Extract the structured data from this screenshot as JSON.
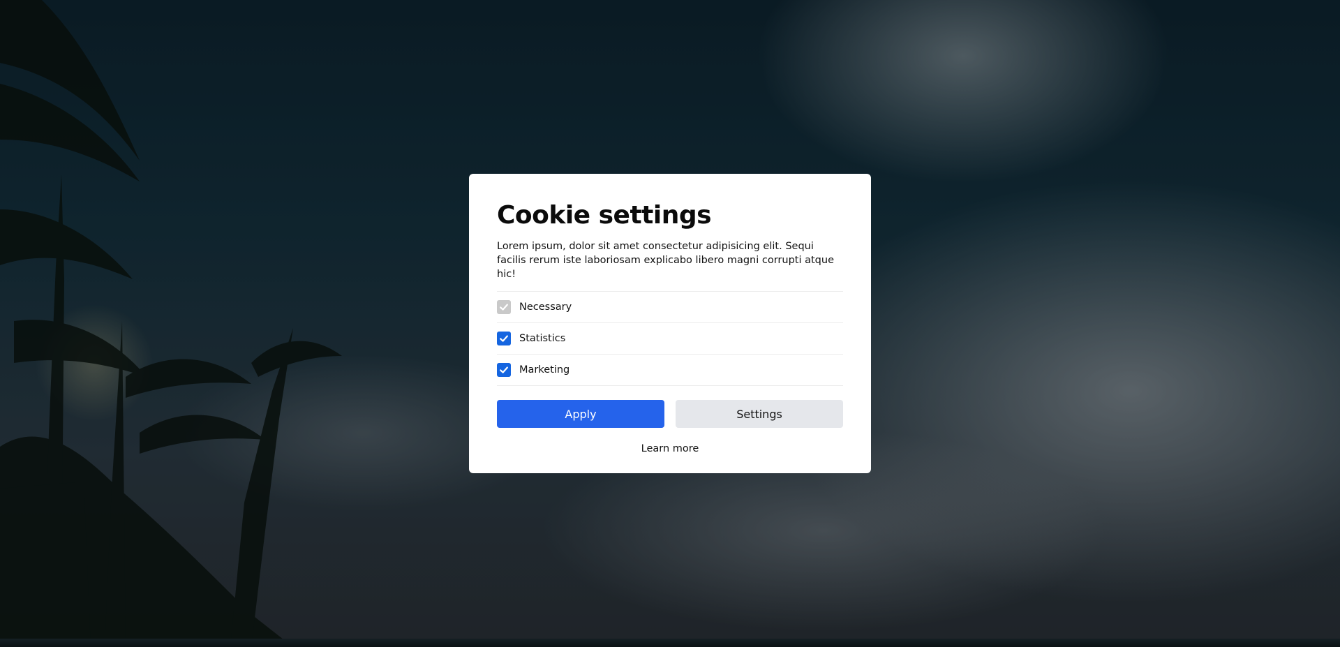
{
  "modal": {
    "title": "Cookie settings",
    "description": "Lorem ipsum, dolor sit amet consectetur adipisicing elit. Sequi facilis rerum iste laboriosam explicabo libero magni corrupti atque hic!",
    "options": [
      {
        "label": "Necessary",
        "checked": true,
        "disabled": true
      },
      {
        "label": "Statistics",
        "checked": true,
        "disabled": false
      },
      {
        "label": "Marketing",
        "checked": true,
        "disabled": false
      }
    ],
    "apply_label": "Apply",
    "settings_label": "Settings",
    "learn_more_label": "Learn more"
  },
  "icons": {
    "checkbox_check": "check-icon"
  },
  "colors": {
    "primary": "#2563eb",
    "checkbox_active": "#1565e0",
    "checkbox_disabled": "#c9c9c9",
    "secondary_button": "#e5e7eb"
  }
}
